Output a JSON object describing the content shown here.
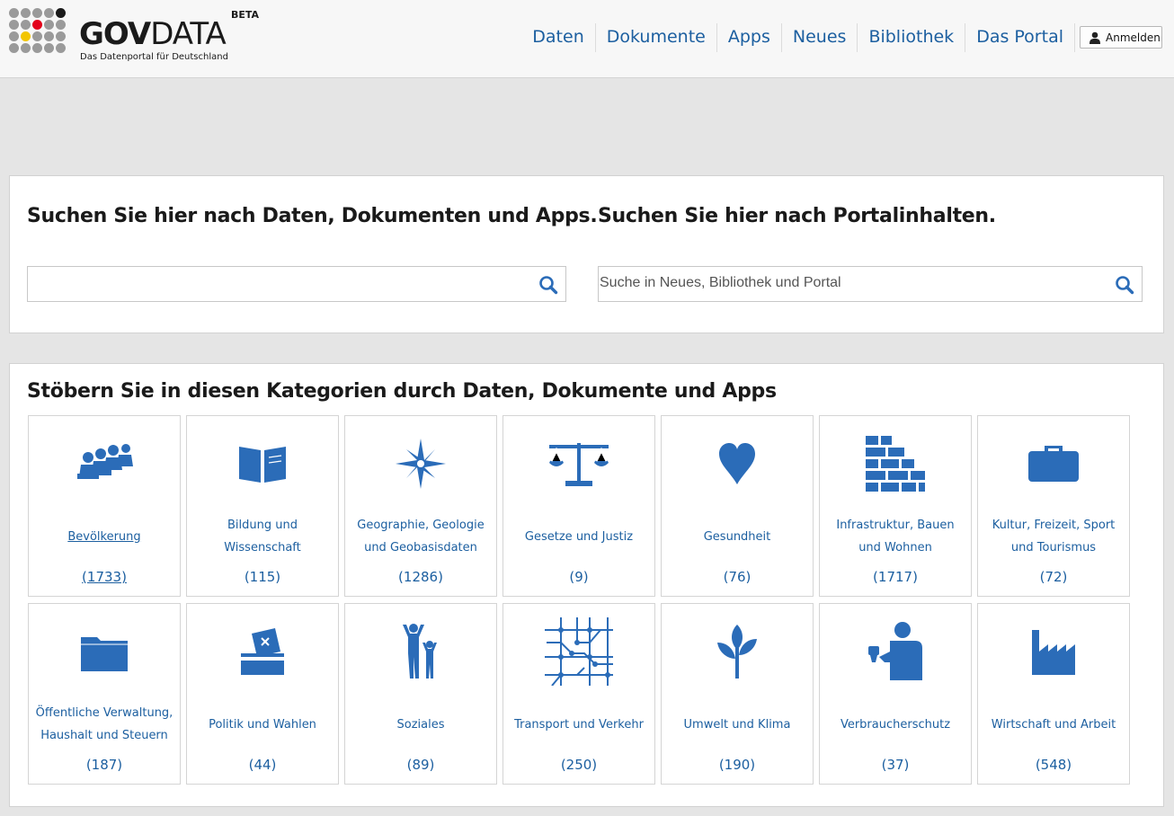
{
  "header": {
    "logo_text_bold": "GOV",
    "logo_text_light": "DATA",
    "logo_beta": "BETA",
    "logo_subtitle": "Das Datenportal für Deutschland",
    "nav": [
      {
        "label": "Daten"
      },
      {
        "label": "Dokumente"
      },
      {
        "label": "Apps"
      },
      {
        "label": "Neues"
      },
      {
        "label": "Bibliothek"
      },
      {
        "label": "Das Portal"
      }
    ],
    "login_label": "Anmelden"
  },
  "search": {
    "left_title": "Suchen Sie hier nach Daten, Dokumenten und Apps.",
    "left_value": "",
    "right_title": "Suchen Sie hier nach Portalinhalten.",
    "right_placeholder": "Suche in Neues, Bibliothek und Portal"
  },
  "categories": {
    "title": "Stöbern Sie in diesen Kategorien durch Daten, Dokumente und Apps",
    "items": [
      {
        "label": "Bevölkerung",
        "count": "(1733)",
        "icon": "population-icon"
      },
      {
        "label": "Bildung und Wissenschaft",
        "count": "(115)",
        "icon": "book-icon"
      },
      {
        "label": "Geographie, Geologie und Geobasisdaten",
        "count": "(1286)",
        "icon": "compass-rose-icon"
      },
      {
        "label": "Gesetze und Justiz",
        "count": "(9)",
        "icon": "scales-icon"
      },
      {
        "label": "Gesundheit",
        "count": "(76)",
        "icon": "heart-icon"
      },
      {
        "label": "Infrastruktur, Bauen und Wohnen",
        "count": "(1717)",
        "icon": "brick-wall-icon"
      },
      {
        "label": "Kultur, Freizeit, Sport und Tourismus",
        "count": "(72)",
        "icon": "suitcase-icon"
      },
      {
        "label": "Öffentliche Verwaltung, Haushalt und Steuern",
        "count": "(187)",
        "icon": "folder-icon"
      },
      {
        "label": "Politik und Wahlen",
        "count": "(44)",
        "icon": "ballot-box-icon"
      },
      {
        "label": "Soziales",
        "count": "(89)",
        "icon": "people-icon"
      },
      {
        "label": "Transport und Verkehr",
        "count": "(250)",
        "icon": "transit-map-icon"
      },
      {
        "label": "Umwelt und Klima",
        "count": "(190)",
        "icon": "plant-icon"
      },
      {
        "label": "Verbraucherschutz",
        "count": "(37)",
        "icon": "consumer-icon"
      },
      {
        "label": "Wirtschaft und Arbeit",
        "count": "(548)",
        "icon": "factory-icon"
      }
    ]
  },
  "colors": {
    "link_blue": "#1c5fa0",
    "icon_blue": "#2b6cb8",
    "logo_red": "#e3001b",
    "logo_gold": "#f2c500",
    "logo_black": "#1a1a1a"
  }
}
